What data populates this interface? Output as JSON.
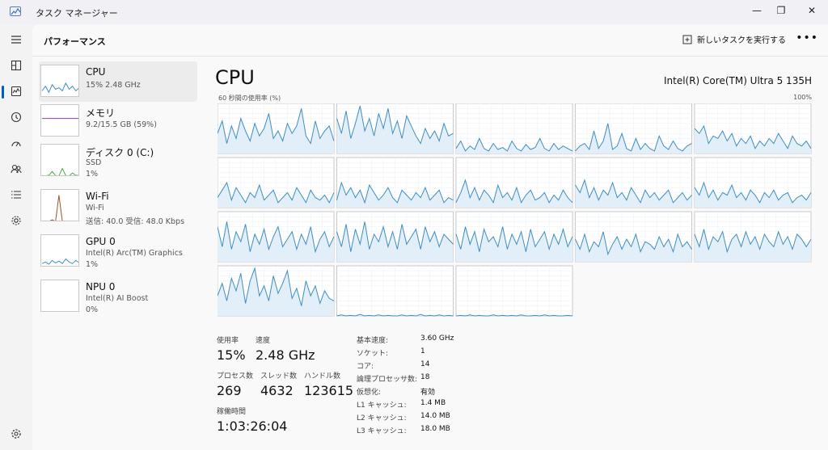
{
  "window": {
    "title": "タスク マネージャー",
    "minimize": "—",
    "maximize": "❐",
    "close": "✕"
  },
  "nav": [
    "menu-icon",
    "processes-icon",
    "performance-icon",
    "history-icon",
    "startup-icon",
    "users-icon",
    "details-icon",
    "services-icon",
    "settings-icon"
  ],
  "header": {
    "title": "パフォーマンス",
    "run_task": "新しいタスクを実行する",
    "more": "•••"
  },
  "resources": [
    {
      "name": "CPU",
      "sub1": "15%  2.48 GHz",
      "sub2": ""
    },
    {
      "name": "メモリ",
      "sub1": "9.2/15.5 GB (59%)",
      "sub2": ""
    },
    {
      "name": "ディスク 0 (C:)",
      "sub1": "SSD",
      "sub2": "1%"
    },
    {
      "name": "Wi-Fi",
      "sub1": "Wi-Fi",
      "sub2": "送信: 40.0  受信: 48.0 Kbps"
    },
    {
      "name": "GPU 0",
      "sub1": "Intel(R) Arc(TM) Graphics",
      "sub2": "1%"
    },
    {
      "name": "NPU 0",
      "sub1": "Intel(R) AI Boost",
      "sub2": "0%"
    }
  ],
  "main": {
    "title": "CPU",
    "model": "Intel(R) Core(TM) Ultra 5 135H",
    "axis_label": "60 秒間の使用率 (%)",
    "axis_max": "100%"
  },
  "stats": {
    "usage_label": "使用率",
    "usage_value": "15%",
    "speed_label": "速度",
    "speed_value": "2.48 GHz",
    "processes_label": "プロセス数",
    "processes_value": "269",
    "threads_label": "スレッド数",
    "threads_value": "4632",
    "handles_label": "ハンドル数",
    "handles_value": "123615",
    "uptime_label": "稼働時間",
    "uptime_value": "1:03:26:04"
  },
  "specs": [
    {
      "key": "基本速度:",
      "value": "3.60 GHz"
    },
    {
      "key": "ソケット:",
      "value": "1"
    },
    {
      "key": "コア:",
      "value": "14"
    },
    {
      "key": "論理プロセッサ数:",
      "value": "18"
    },
    {
      "key": "仮想化:",
      "value": "有効"
    },
    {
      "key": "L1 キャッシュ:",
      "value": "1.4 MB"
    },
    {
      "key": "L2 キャッシュ:",
      "value": "14.0 MB"
    },
    {
      "key": "L3 キャッシュ:",
      "value": "18.0 MB"
    }
  ],
  "colors": {
    "cpu_line": "#3f8ec2",
    "cpu_fill": "#e3eff8",
    "memory_line": "#8b3fa8",
    "disk_line": "#4aa84a",
    "wifi_line": "#a0522d",
    "accent": "#005fb8"
  },
  "chart_data": {
    "type": "line",
    "title": "60 秒間の使用率 (%)",
    "ylim": [
      0,
      100
    ],
    "grid": true,
    "series": [
      {
        "values": [
          40,
          65,
          20,
          55,
          30,
          70,
          45,
          25,
          60,
          35,
          50,
          80,
          30,
          45,
          25,
          60,
          40,
          55,
          90,
          35,
          20,
          65,
          30,
          45,
          55,
          25
        ]
      },
      {
        "values": [
          70,
          40,
          85,
          30,
          60,
          95,
          45,
          70,
          35,
          80,
          50,
          90,
          40,
          65,
          30,
          75,
          55,
          35,
          20,
          50,
          30,
          45,
          25,
          60,
          35,
          40
        ]
      },
      {
        "values": [
          10,
          25,
          5,
          15,
          8,
          30,
          10,
          5,
          20,
          8,
          12,
          5,
          25,
          10,
          5,
          18,
          8,
          12,
          30,
          10,
          5,
          20,
          8,
          15,
          10,
          5
        ]
      },
      {
        "values": [
          5,
          15,
          20,
          8,
          45,
          10,
          25,
          60,
          8,
          15,
          40,
          10,
          5,
          30,
          8,
          20,
          10,
          5,
          35,
          15,
          8,
          25,
          10,
          5,
          15,
          20
        ]
      },
      {
        "values": [
          50,
          40,
          55,
          20,
          35,
          30,
          45,
          25,
          40,
          15,
          30,
          20,
          35,
          10,
          25,
          15,
          30,
          20,
          40,
          25,
          10,
          35,
          20,
          15,
          25,
          10
        ]
      },
      {
        "values": [
          20,
          35,
          50,
          15,
          40,
          25,
          10,
          30,
          20,
          45,
          15,
          25,
          35,
          10,
          20,
          30,
          15,
          40,
          25,
          10,
          35,
          20,
          15,
          25,
          10,
          30
        ]
      },
      {
        "values": [
          15,
          50,
          25,
          40,
          20,
          35,
          10,
          45,
          30,
          15,
          25,
          40,
          20,
          10,
          35,
          25,
          15,
          30,
          20,
          40,
          15,
          25,
          35,
          10,
          20,
          15
        ]
      },
      {
        "values": [
          10,
          30,
          55,
          20,
          40,
          15,
          35,
          25,
          10,
          45,
          20,
          30,
          15,
          40,
          10,
          25,
          35,
          15,
          20,
          30,
          10,
          25,
          15,
          35,
          20,
          10
        ]
      },
      {
        "values": [
          45,
          30,
          55,
          20,
          40,
          15,
          35,
          25,
          50,
          20,
          30,
          15,
          40,
          25,
          10,
          35,
          20,
          30,
          15,
          25,
          35,
          10,
          20,
          30,
          15,
          25
        ]
      },
      {
        "values": [
          40,
          25,
          50,
          20,
          35,
          15,
          30,
          25,
          45,
          20,
          30,
          15,
          35,
          25,
          10,
          30,
          20,
          35,
          15,
          25,
          30,
          10,
          20,
          25,
          15,
          30
        ]
      },
      {
        "values": [
          70,
          30,
          80,
          25,
          60,
          40,
          75,
          20,
          55,
          35,
          65,
          25,
          50,
          70,
          30,
          45,
          60,
          25,
          55,
          35,
          70,
          20,
          45,
          60,
          30,
          50
        ]
      },
      {
        "values": [
          60,
          30,
          75,
          20,
          65,
          35,
          80,
          25,
          55,
          40,
          70,
          30,
          60,
          25,
          75,
          35,
          50,
          65,
          25,
          70,
          40,
          60,
          30,
          55,
          45,
          35
        ]
      },
      {
        "values": [
          55,
          25,
          70,
          35,
          60,
          20,
          65,
          40,
          50,
          30,
          70,
          25,
          55,
          35,
          60,
          20,
          65,
          30,
          45,
          60,
          25,
          55,
          35,
          65,
          30,
          50
        ]
      },
      {
        "values": [
          45,
          25,
          55,
          20,
          40,
          30,
          60,
          15,
          35,
          50,
          25,
          45,
          30,
          55,
          20,
          40,
          35,
          25,
          50,
          30,
          45,
          20,
          55,
          30,
          40,
          25
        ]
      },
      {
        "values": [
          55,
          30,
          65,
          25,
          50,
          40,
          60,
          20,
          45,
          55,
          30,
          60,
          35,
          50,
          25,
          55,
          40,
          30,
          60,
          35,
          50,
          25,
          55,
          45,
          30,
          45
        ]
      },
      {
        "values": [
          40,
          65,
          30,
          75,
          50,
          85,
          25,
          70,
          95,
          40,
          60,
          30,
          80,
          45,
          65,
          90,
          35,
          55,
          20,
          70,
          40,
          60,
          25,
          50,
          35,
          30
        ]
      },
      {
        "values": [
          0,
          2,
          0,
          1,
          0,
          3,
          0,
          1,
          0,
          2,
          0,
          1,
          0,
          0,
          2,
          0,
          1,
          0,
          3,
          0,
          1,
          0,
          2,
          0,
          1,
          0
        ]
      },
      {
        "values": [
          0,
          1,
          0,
          2,
          0,
          1,
          0,
          0,
          2,
          0,
          1,
          0,
          1,
          0,
          2,
          0,
          0,
          1,
          0,
          2,
          0,
          1,
          0,
          0,
          1,
          0
        ]
      }
    ]
  },
  "thumbnails": {
    "cpu": [
      20,
      35,
      15,
      40,
      25,
      30,
      20,
      45,
      25,
      35,
      20,
      30
    ],
    "memory": [
      59,
      59,
      59,
      59,
      59,
      59,
      59,
      59,
      59,
      59,
      59,
      59
    ],
    "disk": [
      2,
      1,
      3,
      15,
      2,
      1,
      25,
      2,
      1,
      10,
      3,
      2
    ],
    "wifi": [
      0,
      0,
      0,
      5,
      0,
      85,
      0,
      0,
      0,
      0,
      0,
      0
    ],
    "gpu": [
      10,
      15,
      8,
      20,
      12,
      18,
      10,
      25,
      15,
      10,
      20,
      12
    ],
    "npu": [
      0,
      0,
      0,
      0,
      0,
      0,
      0,
      0,
      0,
      0,
      0,
      0
    ]
  }
}
